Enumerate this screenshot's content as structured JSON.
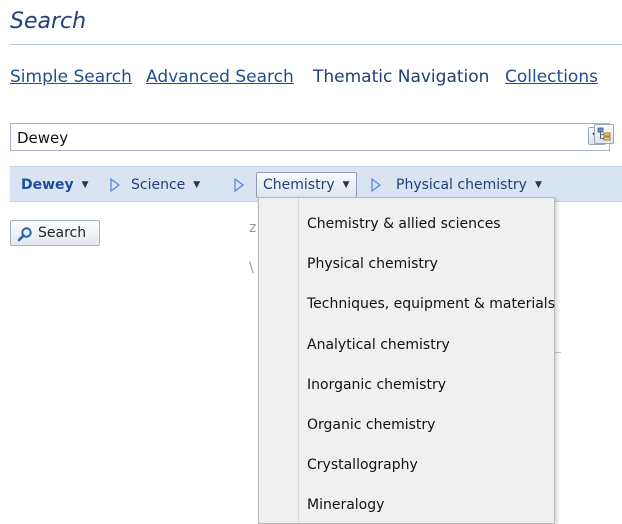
{
  "page_title": "Search",
  "nav_links": {
    "simple": "Simple Search",
    "advanced": "Advanced Search",
    "thematic": "Thematic Navigation",
    "collections": "Collections"
  },
  "classification_select": {
    "value": "Dewey"
  },
  "breadcrumb": {
    "root": "Dewey",
    "level1": "Science",
    "level2": "Chemistry",
    "level3": "Physical chemistry"
  },
  "search_button": {
    "label": "Search"
  },
  "dropdown_menu": {
    "items": [
      "Chemistry & allied sciences",
      "Physical chemistry",
      "Techniques, equipment & materials",
      "Analytical chemistry",
      "Inorganic chemistry",
      "Organic chemistry",
      "Crystallography",
      "Mineralogy"
    ]
  },
  "colors": {
    "accent": "#1f4d9c",
    "bar_background": "#d9e4f2",
    "separator_arrow": "#5a8ad6"
  }
}
